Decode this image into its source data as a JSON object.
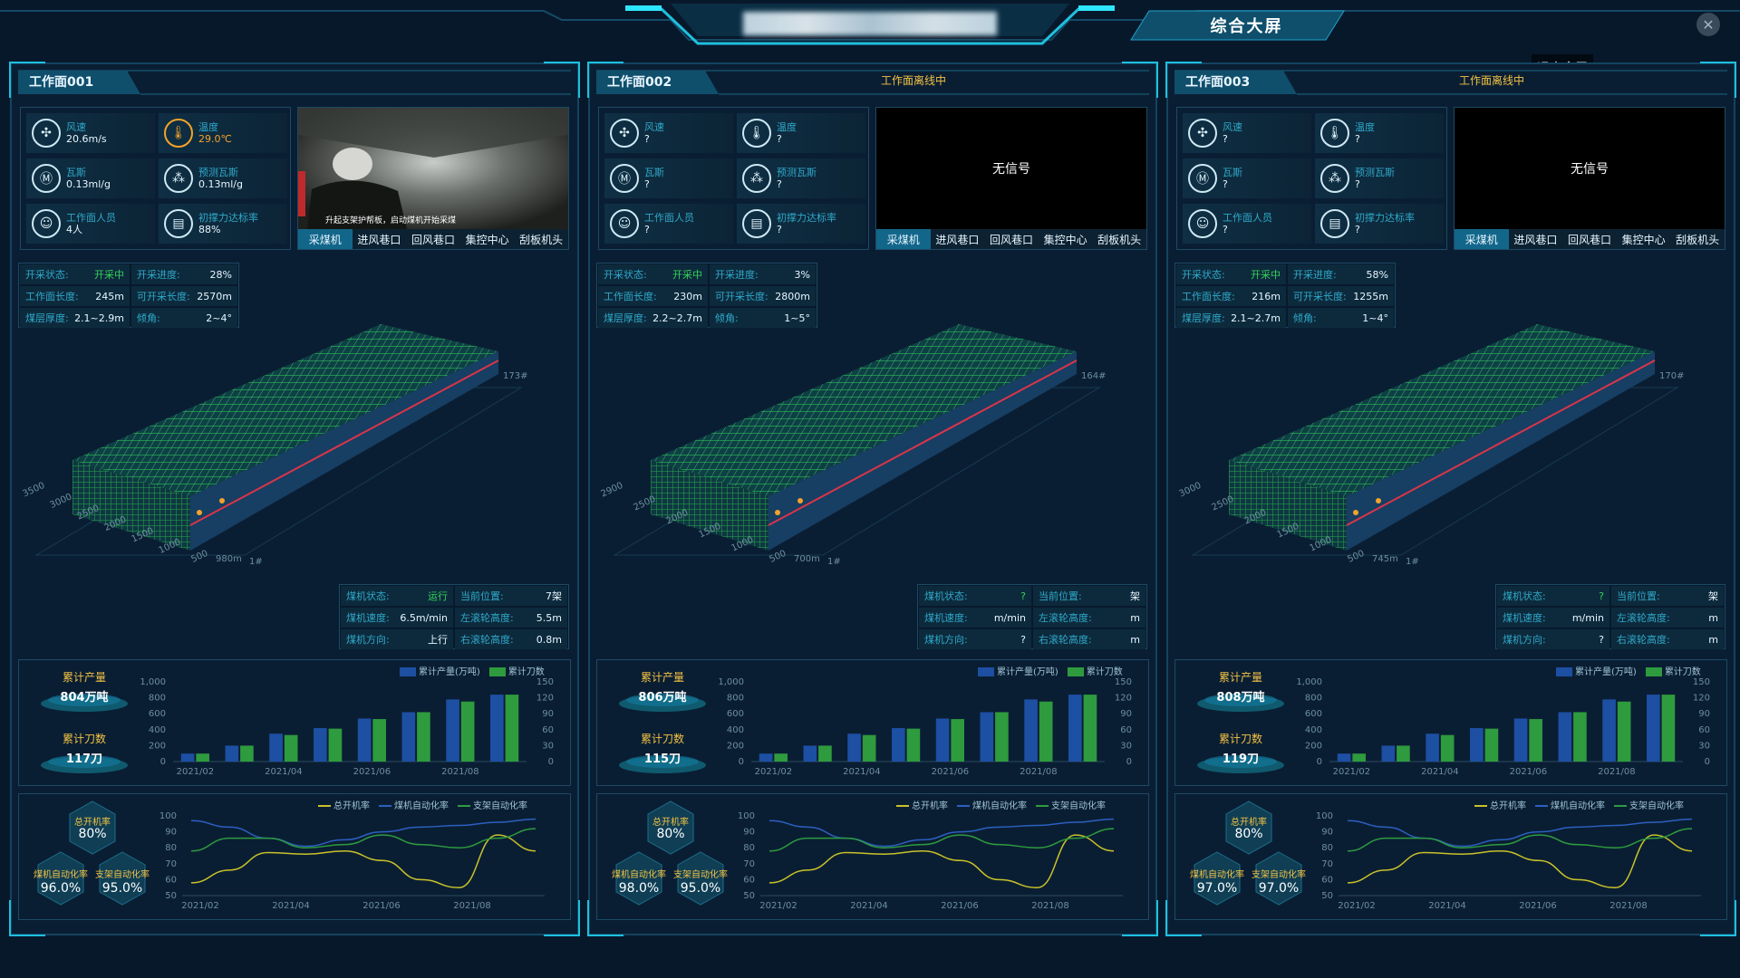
{
  "top": {
    "title_redacted": "",
    "tab_label": "综合大屏",
    "close_icon": "close-icon",
    "exit_fullscreen": "退出全屏"
  },
  "colors": {
    "accent": "#12668a",
    "green": "#35d05a",
    "orange": "#f3c244",
    "blue_bar": "#1d4fa3",
    "green_bar": "#2e9b3e"
  },
  "video_tabs": [
    "采煤机",
    "进风巷口",
    "回风巷口",
    "集控中心",
    "刮板机头"
  ],
  "labels": {
    "wind": "风速",
    "temp": "温度",
    "gas": "瓦斯",
    "pred_gas": "预测瓦斯",
    "people": "工作面人员",
    "support": "初撑力达标率",
    "state": "开采状态:",
    "progress": "开采进度:",
    "face_len": "工作面长度:",
    "mine_len": "可开采长度:",
    "thickness": "煤层厚度:",
    "dip": "倾角:",
    "shearer_state": "煤机状态:",
    "cur_pos": "当前位置:",
    "shearer_speed": "煤机速度:",
    "left_drum": "左滚轮高度:",
    "direction": "煤机方向:",
    "right_drum": "右滚轮高度:",
    "acc_output": "累计产量",
    "acc_cuts": "累计刀数",
    "legend_output": "累计产量(万吨)",
    "legend_cuts": "累计刀数",
    "legend_total": "总开机率",
    "legend_shearer": "煤机自动化率",
    "legend_support": "支架自动化率",
    "total_rate": "总开机率",
    "shearer_rate": "煤机自动化率",
    "support_rate": "支架自动化率"
  },
  "bar_axis": {
    "left_ticks": [
      "1,000",
      "800",
      "600",
      "400",
      "200",
      "0"
    ],
    "right_ticks": [
      "150",
      "120",
      "90",
      "60",
      "30",
      "0"
    ],
    "x_ticks": [
      "2021/02",
      "2021/04",
      "2021/06",
      "2021/08"
    ]
  },
  "line_axis": {
    "y_ticks": [
      "100",
      "90",
      "80",
      "70",
      "60",
      "50"
    ],
    "x_ticks": [
      "2021/02",
      "2021/04",
      "2021/06",
      "2021/08"
    ]
  },
  "panels": [
    {
      "title": "工作面001",
      "offline": "",
      "wind": "20.6m/s",
      "temp": "29.0℃",
      "gas": "0.13ml/g",
      "pred_gas": "0.13ml/g",
      "people": "4人",
      "support": "88%",
      "video_signal": "",
      "video_caption": "升起支架护帮板，启动煤机开始采煤",
      "state": "开采中",
      "progress": "28%",
      "face_len": "245m",
      "mine_len": "2570m",
      "thickness": "2.1~2.9m",
      "dip": "2~4°",
      "end_label": "173#",
      "start_label": "1#",
      "pos_readout": "980m",
      "depth_ticks": [
        "3500",
        "3000",
        "2500",
        "2000",
        "1500",
        "1000",
        "500"
      ],
      "shearer_state": "运行",
      "cur_pos": "7架",
      "shearer_speed": "6.5m/min",
      "left_drum": "5.5m",
      "direction": "上行",
      "right_drum": "0.8m",
      "acc_output": "804万吨",
      "acc_cuts": "117刀",
      "total_rate": "80%",
      "shearer_rate": "96.0%",
      "support_rate": "95.0%"
    },
    {
      "title": "工作面002",
      "offline": "工作面离线中",
      "wind": "?",
      "temp": "?",
      "gas": "?",
      "pred_gas": "?",
      "people": "?",
      "support": "?",
      "video_signal": "无信号",
      "video_caption": "",
      "state": "开采中",
      "progress": "3%",
      "face_len": "230m",
      "mine_len": "2800m",
      "thickness": "2.2~2.7m",
      "dip": "1~5°",
      "end_label": "164#",
      "start_label": "1#",
      "pos_readout": "700m",
      "depth_ticks": [
        "2900",
        "2500",
        "2000",
        "1500",
        "1000",
        "500"
      ],
      "shearer_state": "?",
      "cur_pos": "架",
      "shearer_speed": "m/min",
      "left_drum": "m",
      "direction": "?",
      "right_drum": "m",
      "acc_output": "806万吨",
      "acc_cuts": "115刀",
      "total_rate": "80%",
      "shearer_rate": "98.0%",
      "support_rate": "95.0%"
    },
    {
      "title": "工作面003",
      "offline": "工作面离线中",
      "wind": "?",
      "temp": "?",
      "gas": "?",
      "pred_gas": "?",
      "people": "?",
      "support": "?",
      "video_signal": "无信号",
      "video_caption": "",
      "state": "开采中",
      "progress": "58%",
      "face_len": "216m",
      "mine_len": "1255m",
      "thickness": "2.1~2.7m",
      "dip": "1~4°",
      "end_label": "170#",
      "start_label": "1#",
      "pos_readout": "745m",
      "depth_ticks": [
        "3000",
        "2500",
        "2000",
        "1500",
        "1000",
        "500"
      ],
      "shearer_state": "?",
      "cur_pos": "架",
      "shearer_speed": "m/min",
      "left_drum": "m",
      "direction": "?",
      "right_drum": "m",
      "acc_output": "808万吨",
      "acc_cuts": "119刀",
      "total_rate": "80%",
      "shearer_rate": "97.0%",
      "support_rate": "97.0%"
    }
  ],
  "chart_data": [
    {
      "type": "bar",
      "categories": [
        "2021/02",
        "2021/03",
        "2021/04",
        "2021/05",
        "2021/06",
        "2021/07",
        "2021/08",
        "2021/09"
      ],
      "series": [
        {
          "name": "累计产量(万吨)",
          "values": [
            100,
            200,
            350,
            420,
            540,
            620,
            780,
            840
          ]
        },
        {
          "name": "累计刀数",
          "values": [
            15,
            30,
            50,
            62,
            80,
            93,
            113,
            126
          ]
        }
      ],
      "ylim_left": [
        0,
        1000
      ],
      "ylim_right": [
        0,
        150
      ],
      "legend": "top-right"
    },
    {
      "type": "line",
      "x": [
        "2021/02",
        "2021/04",
        "2021/06",
        "2021/08"
      ],
      "series": [
        {
          "name": "总开机率",
          "values": [
            58,
            66,
            77,
            76,
            78,
            72,
            60,
            55,
            88,
            78
          ]
        },
        {
          "name": "煤机自动化率",
          "values": [
            97,
            93,
            86,
            81,
            85,
            90,
            93,
            94,
            96,
            98
          ]
        },
        {
          "name": "支架自动化率",
          "values": [
            78,
            86,
            86,
            80,
            82,
            88,
            82,
            80,
            86,
            92
          ]
        }
      ],
      "ylim": [
        50,
        100
      ],
      "legend": "top-right"
    }
  ]
}
